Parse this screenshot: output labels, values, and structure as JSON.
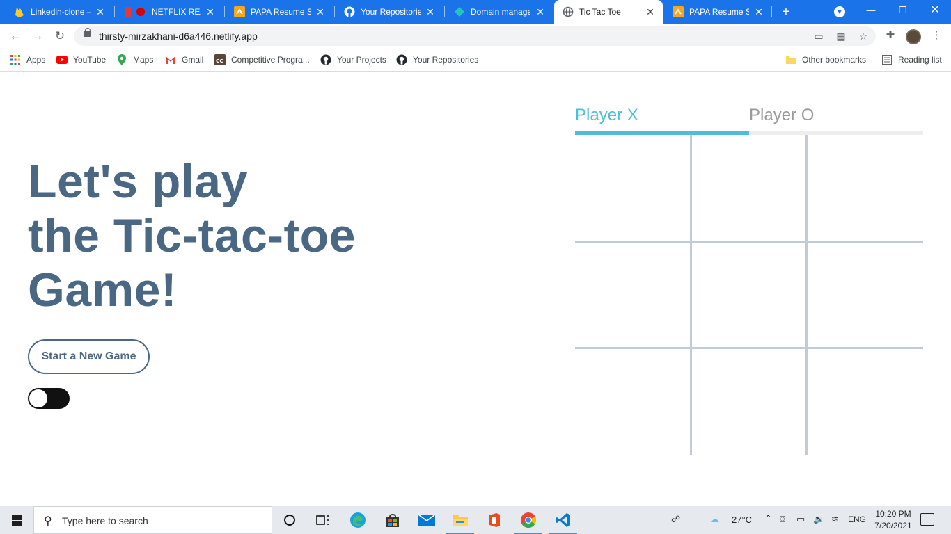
{
  "browser": {
    "tabs": [
      {
        "title": "Linkedin-clone – F",
        "active": false
      },
      {
        "title": "NETFLIX REACT",
        "active": false
      },
      {
        "title": "PAPA Resume Sta",
        "active": false
      },
      {
        "title": "Your Repositories",
        "active": false
      },
      {
        "title": "Domain manager",
        "active": false
      },
      {
        "title": "Tic Tac Toe",
        "active": true
      },
      {
        "title": "PAPA Resume Sta",
        "active": false
      }
    ],
    "close_glyph": "✕",
    "new_tab_glyph": "+",
    "url": "thirsty-mirzakhani-d6a446.netlify.app",
    "bookmarks": [
      "Apps",
      "YouTube",
      "Maps",
      "Gmail",
      "Competitive Progra...",
      "Your Projects",
      "Your Repositories"
    ],
    "other_bookmarks": "Other bookmarks",
    "reading_list": "Reading list",
    "accent_color": "#1a73e8"
  },
  "game": {
    "headline": [
      "Let's play",
      "the Tic-tac-toe",
      "Game!"
    ],
    "new_game_label": "Start a New Game",
    "dark_mode_on": false,
    "players": {
      "x": "Player X",
      "o": "Player O",
      "current": "x"
    },
    "board": [
      "",
      "",
      "",
      "",
      "",
      "",
      "",
      "",
      ""
    ],
    "colors": {
      "heading": "#4a6783",
      "active_player": "#4bbfd6",
      "inactive_player": "#9a9a9a",
      "grid": "#bfcbd6"
    }
  },
  "taskbar": {
    "search_placeholder": "Type here to search",
    "apps": [
      "cortana-icon",
      "task-view-icon",
      "edge-icon",
      "store-icon",
      "mail-icon",
      "file-explorer-icon",
      "office-icon",
      "chrome-icon",
      "vscode-icon"
    ],
    "weather": "27°C",
    "language": "ENG",
    "time": "10:20 PM",
    "date": "7/20/2021"
  }
}
